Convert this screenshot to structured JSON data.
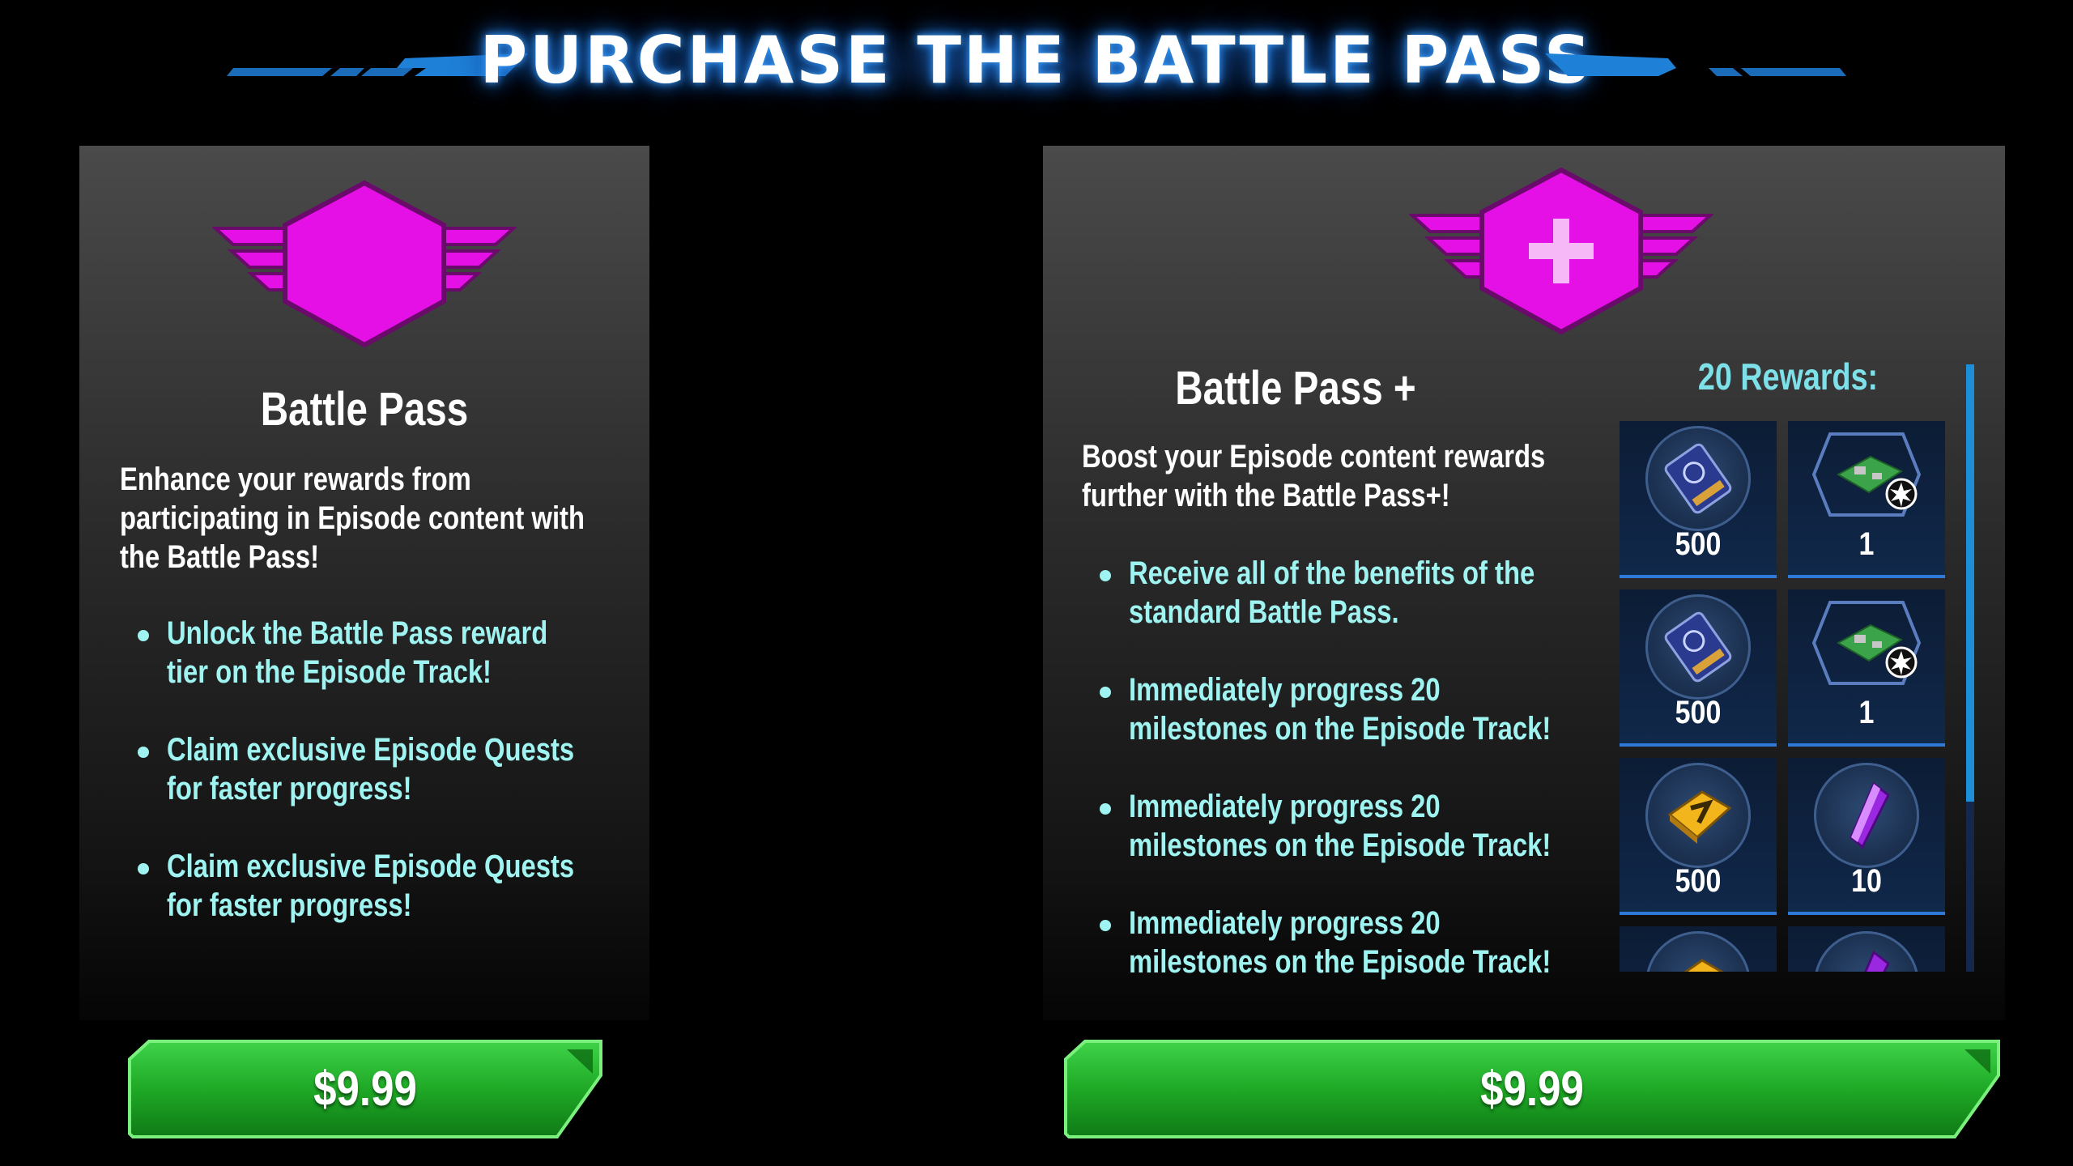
{
  "header": {
    "title": "PURCHASE THE BATTLE PASS"
  },
  "colors": {
    "accent_magenta": "#e510e5",
    "bullet_cyan": "#9ff3f0",
    "button_green": "#22b526",
    "rewards_title": "#7ee0e8"
  },
  "battle_pass": {
    "title": "Battle Pass",
    "emblem_icon": "winged-hexagon-icon",
    "description": [
      "Enhance your rewards from",
      "participating in Episode content with",
      "the Battle Pass!"
    ],
    "bullets": [
      [
        "Unlock the Battle Pass reward",
        "tier on the Episode Track!"
      ],
      [
        "Claim exclusive Episode Quests",
        "for faster progress!"
      ],
      [
        "Claim exclusive Episode Quests",
        "for faster progress!"
      ]
    ],
    "price": "$9.99"
  },
  "battle_pass_plus": {
    "title": "Battle Pass +",
    "emblem_icon": "winged-hexagon-plus-icon",
    "description": [
      "Boost your Episode content rewards",
      "further with the Battle Pass+!"
    ],
    "bullets": [
      [
        "Receive all of the benefits of the",
        "standard Battle Pass."
      ],
      [
        "Immediately progress 20",
        "milestones on the Episode Track!"
      ],
      [
        "Immediately progress 20",
        "milestones on the Episode Track!"
      ],
      [
        "Immediately progress 20",
        "milestones on the Episode Track!"
      ]
    ],
    "rewards_title": "20 Rewards:",
    "rewards": [
      {
        "icon": "tech-chip-icon",
        "qty": "500"
      },
      {
        "icon": "circuit-board-icon",
        "qty": "1"
      },
      {
        "icon": "tech-chip-icon",
        "qty": "500"
      },
      {
        "icon": "circuit-board-icon",
        "qty": "1"
      },
      {
        "icon": "gold-plate-icon",
        "qty": "500"
      },
      {
        "icon": "purple-crystal-icon",
        "qty": "10"
      },
      {
        "icon": "gold-plate-icon",
        "qty": ""
      },
      {
        "icon": "purple-crystal-icon",
        "qty": ""
      }
    ],
    "price": "$9.99"
  }
}
